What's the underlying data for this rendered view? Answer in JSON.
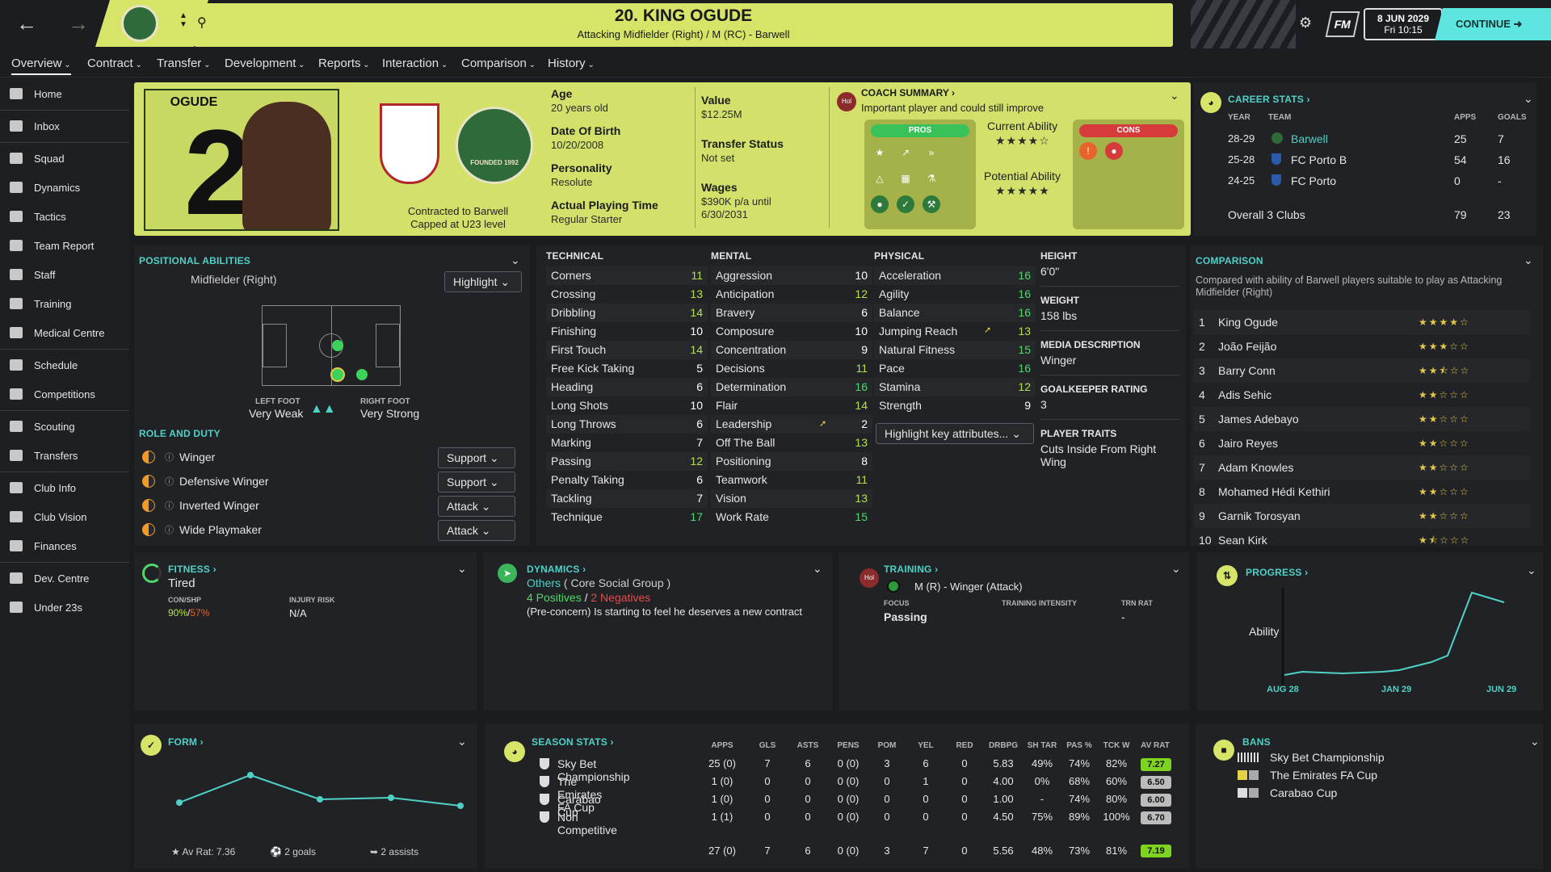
{
  "topbar": {
    "date": "8 JUN 2029",
    "time": "Fri 10:15",
    "continue_label": "CONTINUE",
    "fm_label": "FM"
  },
  "player": {
    "title": "20. KING OGUDE",
    "subtitle": "Attacking Midfielder (Right) / M (RC) - Barwell",
    "surname": "OGUDE",
    "number": "20"
  },
  "tabs": [
    "Overview",
    "Contract",
    "Transfer",
    "Development",
    "Reports",
    "Interaction",
    "Comparison",
    "History"
  ],
  "sidebar": [
    "Home",
    "Inbox",
    "Squad",
    "Dynamics",
    "Tactics",
    "Team Report",
    "Staff",
    "Training",
    "Medical Centre",
    "Schedule",
    "Competitions",
    "Scouting",
    "Transfers",
    "Club Info",
    "Club Vision",
    "Finances",
    "Dev. Centre",
    "Under 23s"
  ],
  "hero": {
    "contracted": "Contracted to Barwell",
    "capped": "Capped at U23 level",
    "badge_text": "FOUNDED 1992",
    "age_label": "Age",
    "age": "20 years old",
    "dob_label": "Date Of Birth",
    "dob": "10/20/2008",
    "personality_label": "Personality",
    "personality": "Resolute",
    "apt_label": "Actual Playing Time",
    "apt": "Regular Starter",
    "value_label": "Value",
    "value": "$12.25M",
    "transfer_label": "Transfer Status",
    "transfer": "Not set",
    "wages_label": "Wages",
    "wages1": "$390K p/a until",
    "wages2": "6/30/2031",
    "coach_header": "COACH SUMMARY",
    "coach_text": "Important player and could still improve",
    "coach_avatar": "Hol",
    "pros_label": "PROS",
    "cons_label": "CONS",
    "ca_label": "Current Ability",
    "ca_stars": "★★★★☆",
    "pa_label": "Potential Ability",
    "pa_stars": "★★★★★"
  },
  "career": {
    "header": "CAREER STATS",
    "cols": [
      "YEAR",
      "TEAM",
      "APPS",
      "GOALS"
    ],
    "rows": [
      [
        "28-29",
        "Barwell",
        "25",
        "7"
      ],
      [
        "25-28",
        "FC Porto B",
        "54",
        "16"
      ],
      [
        "24-25",
        "FC Porto",
        "0",
        "-"
      ]
    ],
    "overall": [
      "Overall 3 Clubs",
      "79",
      "23"
    ]
  },
  "positional": {
    "header": "POSITIONAL ABILITIES",
    "position": "Midfielder (Right)",
    "highlight": "Highlight",
    "left_foot_label": "LEFT FOOT",
    "left_foot": "Very Weak",
    "right_foot_label": "RIGHT FOOT",
    "right_foot": "Very Strong"
  },
  "roles": {
    "header": "ROLE AND DUTY",
    "items": [
      [
        "Winger",
        "Support"
      ],
      [
        "Defensive Winger",
        "Support"
      ],
      [
        "Inverted Winger",
        "Attack"
      ],
      [
        "Wide Playmaker",
        "Attack"
      ]
    ]
  },
  "technical": {
    "header": "TECHNICAL",
    "rows": [
      [
        "Corners",
        "11"
      ],
      [
        "Crossing",
        "13"
      ],
      [
        "Dribbling",
        "14"
      ],
      [
        "Finishing",
        "10"
      ],
      [
        "First Touch",
        "14"
      ],
      [
        "Free Kick Taking",
        "5"
      ],
      [
        "Heading",
        "6"
      ],
      [
        "Long Shots",
        "10"
      ],
      [
        "Long Throws",
        "6"
      ],
      [
        "Marking",
        "7"
      ],
      [
        "Passing",
        "12"
      ],
      [
        "Penalty Taking",
        "6"
      ],
      [
        "Tackling",
        "7"
      ],
      [
        "Technique",
        "17"
      ]
    ]
  },
  "mental": {
    "header": "MENTAL",
    "rows": [
      [
        "Aggression",
        "10"
      ],
      [
        "Anticipation",
        "12"
      ],
      [
        "Bravery",
        "6"
      ],
      [
        "Composure",
        "10"
      ],
      [
        "Concentration",
        "9"
      ],
      [
        "Decisions",
        "11"
      ],
      [
        "Determination",
        "16"
      ],
      [
        "Flair",
        "14"
      ],
      [
        "Leadership",
        "2"
      ],
      [
        "Off The Ball",
        "13"
      ],
      [
        "Positioning",
        "8"
      ],
      [
        "Teamwork",
        "11"
      ],
      [
        "Vision",
        "13"
      ],
      [
        "Work Rate",
        "15"
      ]
    ]
  },
  "physical": {
    "header": "PHYSICAL",
    "rows": [
      [
        "Acceleration",
        "16"
      ],
      [
        "Agility",
        "16"
      ],
      [
        "Balance",
        "16"
      ],
      [
        "Jumping Reach",
        "13"
      ],
      [
        "Natural Fitness",
        "15"
      ],
      [
        "Pace",
        "16"
      ],
      [
        "Stamina",
        "12"
      ],
      [
        "Strength",
        "9"
      ]
    ],
    "highlight_btn": "Highlight key attributes..."
  },
  "info": {
    "height_label": "HEIGHT",
    "height": "6'0\"",
    "weight_label": "WEIGHT",
    "weight": "158 lbs",
    "media_label": "MEDIA DESCRIPTION",
    "media": "Winger",
    "gk_label": "GOALKEEPER RATING",
    "gk": "3",
    "traits_label": "PLAYER TRAITS",
    "traits": "Cuts Inside From Right Wing"
  },
  "comparison": {
    "header": "COMPARISON",
    "desc": "Compared with ability of Barwell players suitable to play as Attacking Midfielder (Right)",
    "rows": [
      [
        "1",
        "King Ogude",
        "★★★★☆"
      ],
      [
        "2",
        "João Feijão",
        "★★★☆☆"
      ],
      [
        "3",
        "Barry Conn",
        "★★⯪☆☆"
      ],
      [
        "4",
        "Adis Sehic",
        "★★☆☆☆"
      ],
      [
        "5",
        "James Adebayo",
        "★★☆☆☆"
      ],
      [
        "6",
        "Jairo Reyes",
        "★★☆☆☆"
      ],
      [
        "7",
        "Adam Knowles",
        "★★☆☆☆"
      ],
      [
        "8",
        "Mohamed Hédi Kethiri",
        "★★☆☆☆"
      ],
      [
        "9",
        "Garnik Torosyan",
        "★★☆☆☆"
      ],
      [
        "10",
        "Sean Kirk",
        "★⯪☆☆☆"
      ]
    ]
  },
  "fitness": {
    "header": "FITNESS",
    "state": "Tired",
    "conshp_label": "CON/SHP",
    "con": "90%",
    "shp": "57%",
    "injury_label": "INJURY RISK",
    "injury": "N/A"
  },
  "dynamics": {
    "header": "DYNAMICS",
    "group": "Others",
    "group_note": "( Core Social Group )",
    "positives": "4 Positives",
    "negatives": "2 Negatives",
    "note": "(Pre-concern) Is starting to feel he deserves a new contract"
  },
  "training": {
    "header": "TRAINING",
    "role": "M (R) - Winger (Attack)",
    "focus_label": "FOCUS",
    "focus": "Passing",
    "intensity_label": "TRAINING INTENSITY",
    "trn_label": "TRN RAT",
    "trn": "-",
    "avatar": "Hol"
  },
  "progress": {
    "header": "PROGRESS",
    "ylabel": "Ability",
    "ticks": [
      "AUG 28",
      "JAN 29",
      "JUN 29"
    ]
  },
  "form": {
    "header": "FORM",
    "avrat": "Av Rat: 7.36",
    "goals": "2 goals",
    "assists": "2 assists"
  },
  "season": {
    "header": "SEASON STATS",
    "cols": [
      "APPS",
      "GLS",
      "ASTS",
      "PENS",
      "POM",
      "YEL",
      "RED",
      "DRBPG",
      "SH TAR",
      "PAS %",
      "TCK W",
      "AV RAT"
    ],
    "rows": [
      [
        "Sky Bet Championship",
        "25 (0)",
        "7",
        "6",
        "0 (0)",
        "3",
        "6",
        "0",
        "5.83",
        "49%",
        "74%",
        "82%",
        "7.27"
      ],
      [
        "The Emirates FA Cup",
        "1 (0)",
        "0",
        "0",
        "0 (0)",
        "0",
        "1",
        "0",
        "4.00",
        "0%",
        "68%",
        "60%",
        "6.50"
      ],
      [
        "Carabao Cup",
        "1 (0)",
        "0",
        "0",
        "0 (0)",
        "0",
        "0",
        "0",
        "1.00",
        "-",
        "74%",
        "80%",
        "6.00"
      ],
      [
        "Non Competitive",
        "1 (1)",
        "0",
        "0",
        "0 (0)",
        "0",
        "0",
        "0",
        "4.50",
        "75%",
        "89%",
        "100%",
        "6.70"
      ]
    ],
    "totals": [
      "27 (0)",
      "7",
      "6",
      "0 (0)",
      "3",
      "7",
      "0",
      "5.56",
      "48%",
      "73%",
      "81%",
      "7.19"
    ]
  },
  "bans": {
    "header": "BANS",
    "items": [
      "Sky Bet Championship",
      "The Emirates FA Cup",
      "Carabao Cup"
    ]
  },
  "colors": {
    "accent": "#d6e468",
    "teal": "#4fd1c7",
    "green": "#4fd96b",
    "bg": "#1a1c1f"
  }
}
